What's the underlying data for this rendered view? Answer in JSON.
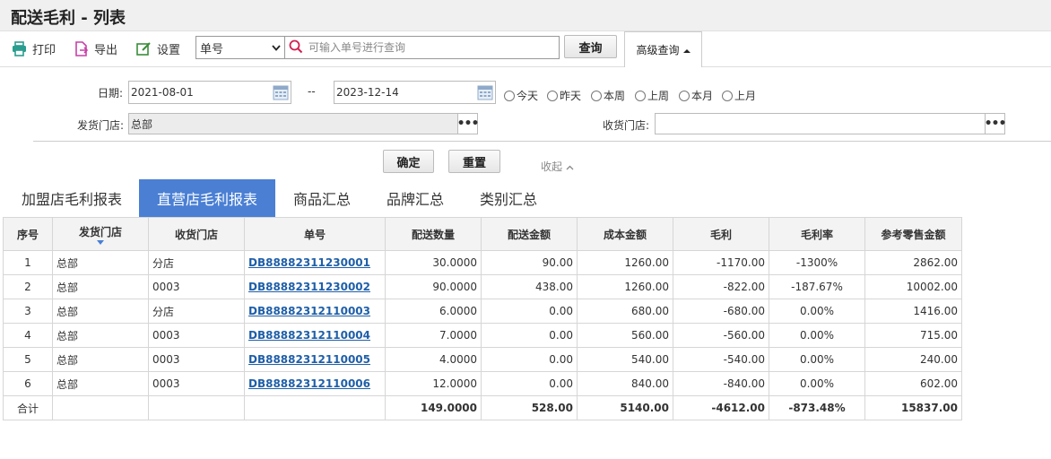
{
  "page": {
    "title": "配送毛利 - 列表"
  },
  "toolbar": {
    "print_label": "打印",
    "export_label": "导出",
    "settings_label": "设置",
    "search_field_selected": "单号",
    "search_placeholder": "可输入单号进行查询",
    "search_value": "",
    "query_label": "查询",
    "advanced_label": "高级查询"
  },
  "filters": {
    "date_label": "日期:",
    "date_from": "2021-08-01",
    "date_sep": "--",
    "date_to": "2023-12-14",
    "quick_dates": [
      "今天",
      "昨天",
      "本周",
      "上周",
      "本月",
      "上月"
    ],
    "ship_store_label": "发货门店:",
    "ship_store_value": "总部",
    "recv_store_label": "收货门店:",
    "recv_store_value": "",
    "confirm_label": "确定",
    "reset_label": "重置",
    "collapse_label": "收起"
  },
  "tabs": [
    "加盟店毛利报表",
    "直营店毛利报表",
    "商品汇总",
    "品牌汇总",
    "类别汇总"
  ],
  "active_tab": "直营店毛利报表",
  "table": {
    "columns": [
      "序号",
      "发货门店",
      "收货门店",
      "单号",
      "配送数量",
      "配送金额",
      "成本金额",
      "毛利",
      "毛利率",
      "参考零售金额"
    ],
    "rows": [
      [
        "1",
        "总部",
        "分店",
        "DB88882311230001",
        "30.0000",
        "90.00",
        "1260.00",
        "-1170.00",
        "-1300%",
        "2862.00"
      ],
      [
        "2",
        "总部",
        "0003",
        "DB88882311230002",
        "90.0000",
        "438.00",
        "1260.00",
        "-822.00",
        "-187.67%",
        "10002.00"
      ],
      [
        "3",
        "总部",
        "分店",
        "DB88882312110003",
        "6.0000",
        "0.00",
        "680.00",
        "-680.00",
        "0.00%",
        "1416.00"
      ],
      [
        "4",
        "总部",
        "0003",
        "DB88882312110004",
        "7.0000",
        "0.00",
        "560.00",
        "-560.00",
        "0.00%",
        "715.00"
      ],
      [
        "5",
        "总部",
        "0003",
        "DB88882312110005",
        "4.0000",
        "0.00",
        "540.00",
        "-540.00",
        "0.00%",
        "240.00"
      ],
      [
        "6",
        "总部",
        "0003",
        "DB88882312110006",
        "12.0000",
        "0.00",
        "840.00",
        "-840.00",
        "0.00%",
        "602.00"
      ]
    ],
    "total": [
      "合计",
      "",
      "",
      "",
      "149.0000",
      "528.00",
      "5140.00",
      "-4612.00",
      "-873.48%",
      "15837.00"
    ]
  },
  "colors": {
    "accent": "#4a7fd4",
    "link": "#1f5fa8",
    "print_icon": "#2a9d8f",
    "export_icon": "#c93fa8",
    "settings_icon": "#3a8d3a"
  },
  "icons": [
    "printer-icon",
    "export-icon",
    "edit-icon",
    "search-icon",
    "calendar-icon"
  ]
}
